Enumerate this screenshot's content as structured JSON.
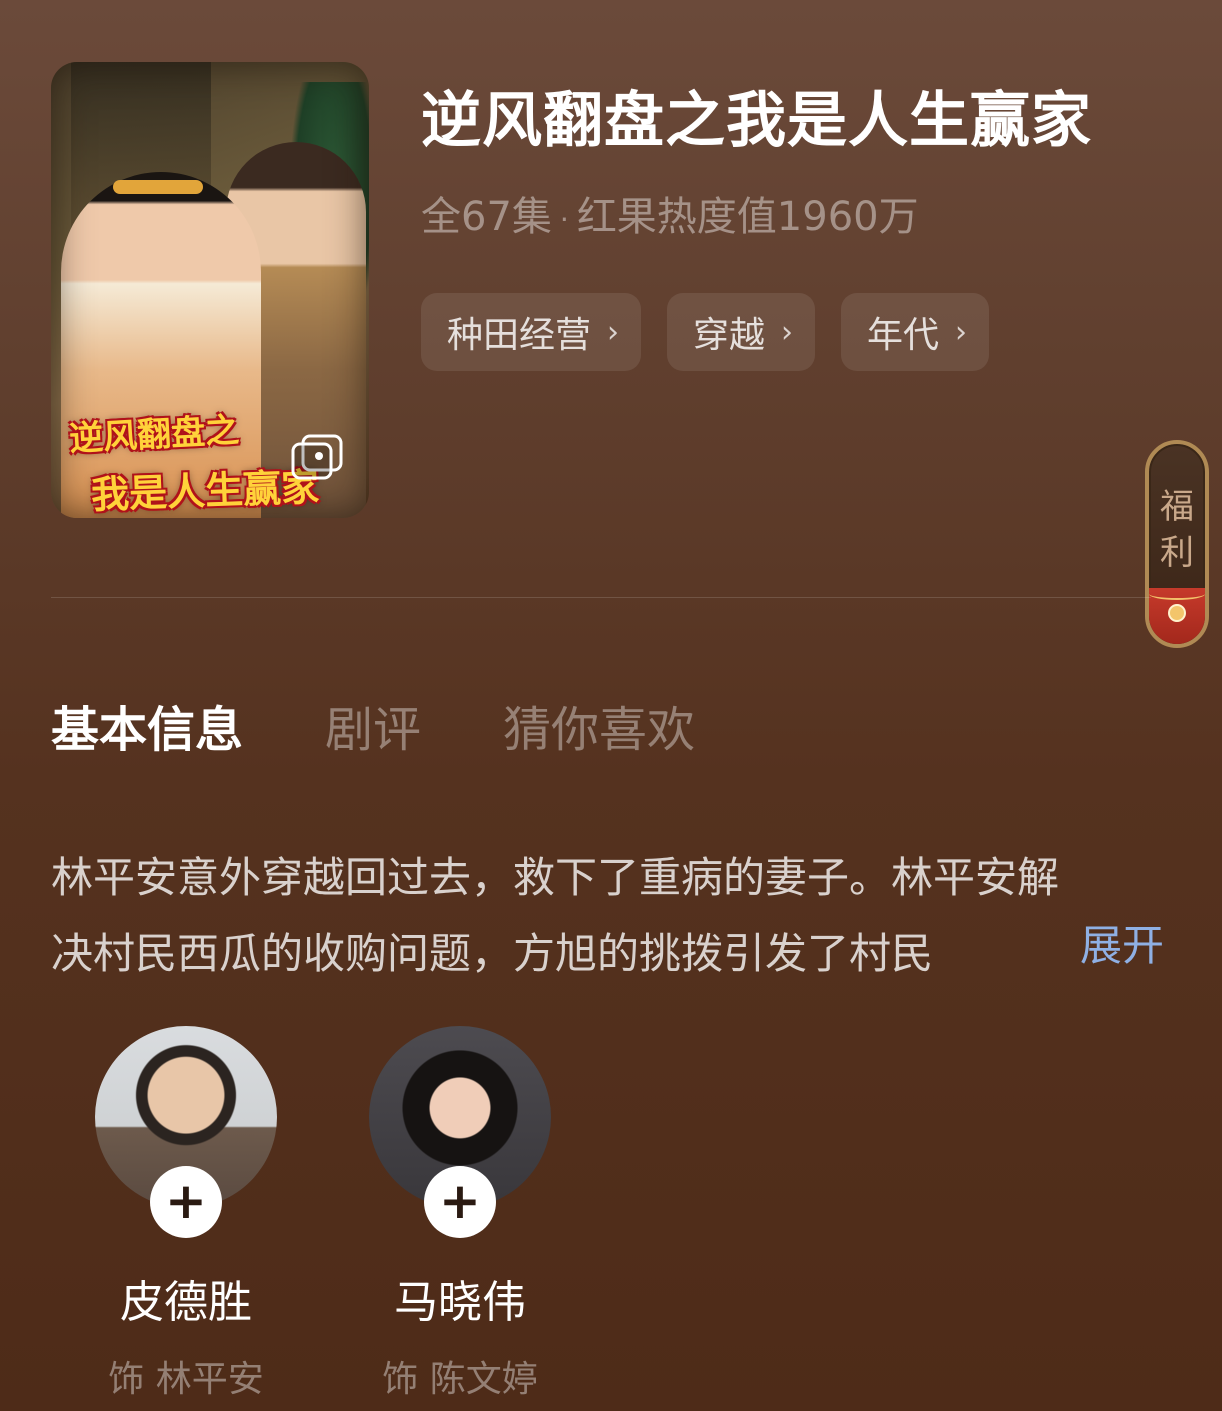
{
  "poster": {
    "title_line1": "逆风翻盘之",
    "title_line2": "我是人生赢家",
    "gallery_icon": "gallery-icon"
  },
  "show": {
    "title": "逆风翻盘之我是人生赢家",
    "episodes": "全67集",
    "separator": "·",
    "heat": "红果热度值1960万"
  },
  "tags": [
    {
      "label": "种田经营"
    },
    {
      "label": "穿越"
    },
    {
      "label": "年代"
    }
  ],
  "tag_chevron": "›",
  "welfare": {
    "line1": "福",
    "line2": "利"
  },
  "tabs": [
    {
      "label": "基本信息",
      "active": true
    },
    {
      "label": "剧评",
      "active": false
    },
    {
      "label": "猜你喜欢",
      "active": false
    }
  ],
  "synopsis": {
    "line1": "林平安意外穿越回过去，救下了重病的妻子。林平安解",
    "line2": "决村民西瓜的收购问题，方旭的挑拨引发了村民",
    "expand_label": "展开"
  },
  "cast": [
    {
      "name": "皮德胜",
      "role": "饰 林平安",
      "follow": "+"
    },
    {
      "name": "马晓伟",
      "role": "饰 陈文婷",
      "follow": "+"
    }
  ],
  "colors": {
    "background_top": "#6b4a3a",
    "background_bottom": "#4e2b18",
    "link": "#8fb0e4",
    "poster_title": "#ffd23a"
  }
}
